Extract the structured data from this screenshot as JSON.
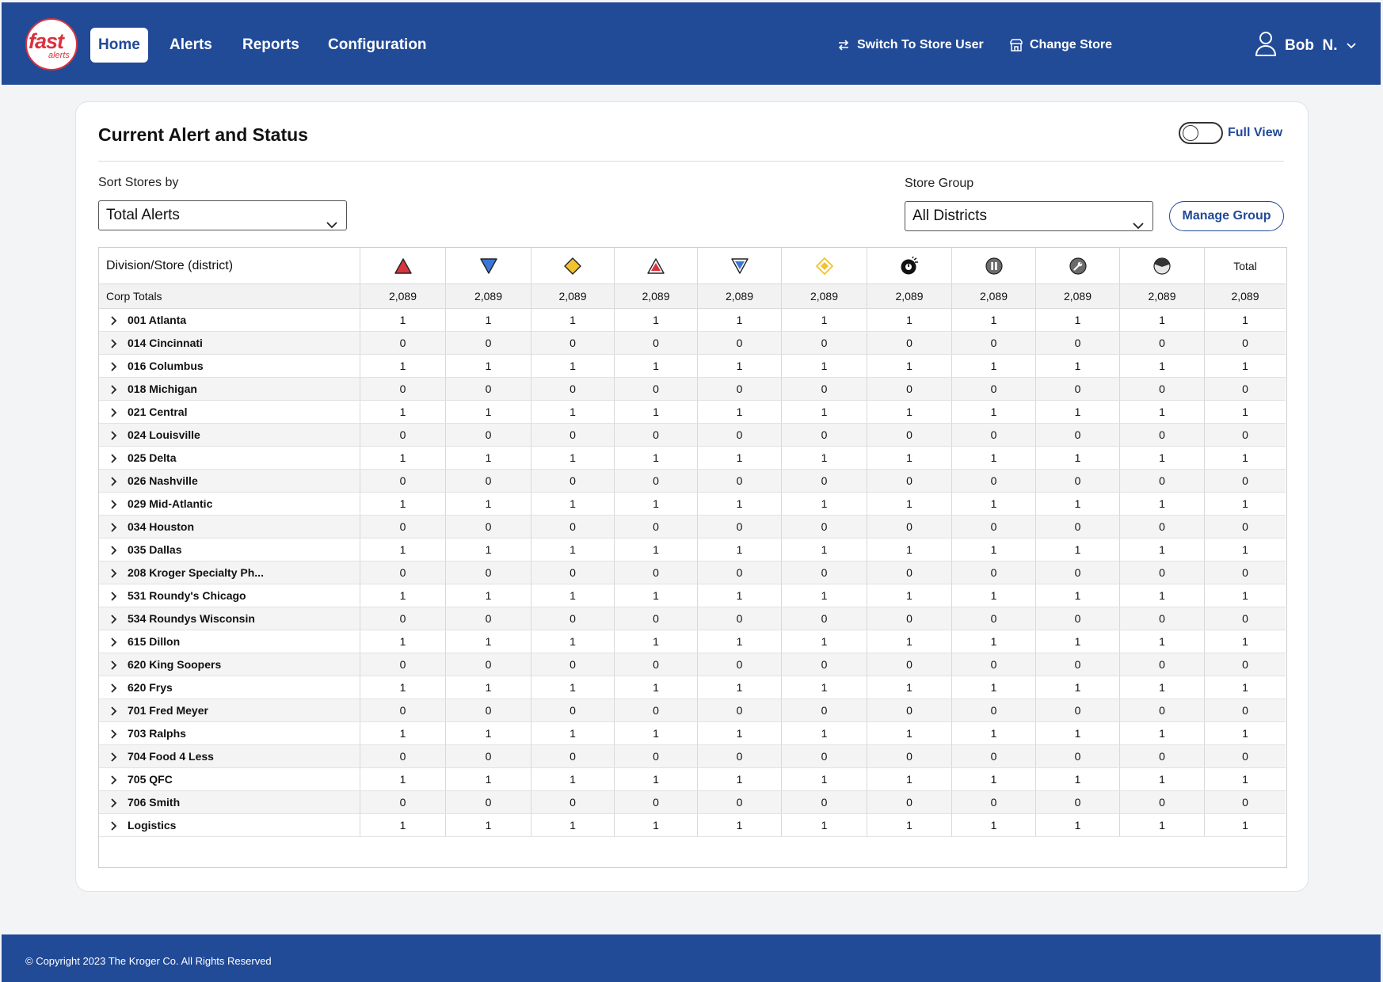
{
  "header": {
    "logo_text": "fast",
    "logo_sub": "alerts",
    "nav": [
      {
        "label": "Home"
      },
      {
        "label": "Alerts"
      },
      {
        "label": "Reports"
      },
      {
        "label": "Configuration"
      }
    ],
    "switch_user_label": "Switch To Store User",
    "change_store_label": "Change Store",
    "user_name": "Bob  N."
  },
  "card": {
    "title": "Current Alert and Status",
    "full_view_label": "Full View",
    "full_view_on": false,
    "sort_label": "Sort Stores by",
    "sort_value": "Total Alerts",
    "group_label": "Store Group",
    "group_value": "All Districts",
    "manage_group_label": "Manage Group"
  },
  "table": {
    "first_header": "Division/Store (district)",
    "icon_columns": [
      "critical-red-up-triangle-icon",
      "blue-down-triangle-icon",
      "yellow-diamond-icon",
      "red-outline-triangle-icon",
      "blue-outline-down-triangle-icon",
      "yellow-outline-diamond-icon",
      "bomb-timer-icon",
      "pause-icon",
      "wrench-icon",
      "half-moon-icon"
    ],
    "total_header": "Total",
    "corp": {
      "label": "Corp Totals",
      "values": [
        "2,089",
        "2,089",
        "2,089",
        "2,089",
        "2,089",
        "2,089",
        "2,089",
        "2,089",
        "2,089",
        "2,089",
        "2,089"
      ]
    },
    "rows": [
      {
        "name": "001 Atlanta",
        "v": "1"
      },
      {
        "name": "014 Cincinnati",
        "v": "0"
      },
      {
        "name": "016 Columbus",
        "v": "1"
      },
      {
        "name": "018 Michigan",
        "v": "0"
      },
      {
        "name": "021 Central",
        "v": "1"
      },
      {
        "name": "024 Louisville",
        "v": "0"
      },
      {
        "name": "025 Delta",
        "v": "1"
      },
      {
        "name": "026 Nashville",
        "v": "0"
      },
      {
        "name": "029 Mid-Atlantic",
        "v": "1"
      },
      {
        "name": "034 Houston",
        "v": "0"
      },
      {
        "name": "035 Dallas",
        "v": "1"
      },
      {
        "name": "208 Kroger Specialty Ph...",
        "v": "0"
      },
      {
        "name": "531 Roundy's Chicago",
        "v": "1"
      },
      {
        "name": "534 Roundys Wisconsin",
        "v": "0"
      },
      {
        "name": "615 Dillon",
        "v": "1"
      },
      {
        "name": "620 King Soopers",
        "v": "0"
      },
      {
        "name": "620 Frys",
        "v": "1"
      },
      {
        "name": "701 Fred Meyer",
        "v": "0"
      },
      {
        "name": "703 Ralphs",
        "v": "1"
      },
      {
        "name": "704 Food 4 Less",
        "v": "0"
      },
      {
        "name": "705 QFC",
        "v": "1"
      },
      {
        "name": "706 Smith",
        "v": "0"
      },
      {
        "name": "Logistics",
        "v": "1"
      }
    ]
  },
  "footer": {
    "copyright": "© Copyright 2023 The Kroger Co. All Rights Reserved"
  },
  "colors": {
    "brand_blue": "#214a97",
    "alert_red": "#d9333f",
    "warn_yellow": "#f2c230"
  }
}
